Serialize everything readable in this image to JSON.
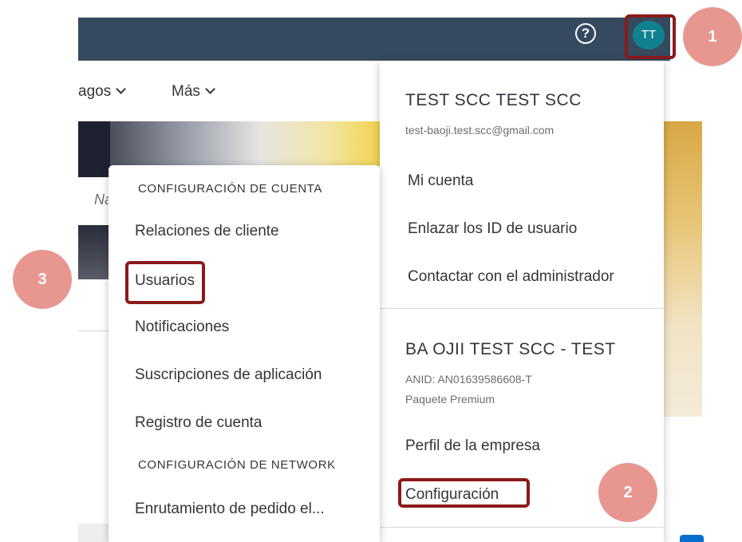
{
  "header": {
    "help_label": "?",
    "avatar_initials": "TT"
  },
  "nav": {
    "item_pagos": "agos",
    "item_mas": "Más"
  },
  "background": {
    "partial_text": "Na"
  },
  "user_menu": {
    "name": "TEST SCC TEST SCC",
    "email": "test-baoji.test.scc@gmail.com",
    "items": [
      "Mi cuenta",
      "Enlazar los ID de usuario",
      "Contactar con el administrador"
    ],
    "company": "BA OJII TEST SCC - TEST",
    "anid": "ANID: AN01639586608-T",
    "package": "Paquete Premium",
    "company_profile": "Perfil de la empresa",
    "settings": "Configuración"
  },
  "config_menu": {
    "account_section": "CONFIGURACIÓN DE CUENTA",
    "account_items": [
      "Relaciones de cliente",
      "Usuarios",
      "Notificaciones",
      "Suscripciones de aplicación",
      "Registro de cuenta"
    ],
    "network_section": "CONFIGURACIÓN DE NETWORK",
    "network_items": [
      "Enrutamiento de pedido el..."
    ]
  },
  "steps": [
    "1",
    "2",
    "3"
  ],
  "colors": {
    "topbar": "#354a5f",
    "avatar": "#0f828f",
    "highlight": "#8b1a1a",
    "step_badge": "#e79790"
  }
}
